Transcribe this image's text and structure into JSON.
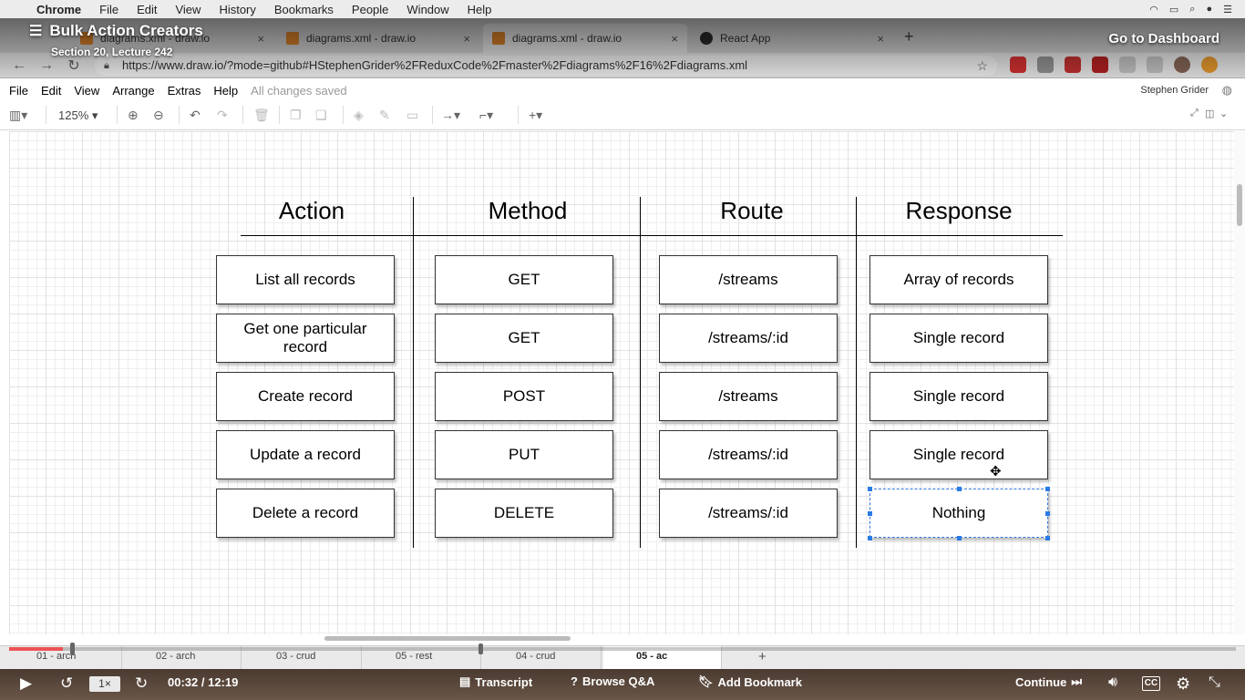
{
  "mac_menu": {
    "app": "Chrome",
    "items": [
      "File",
      "Edit",
      "View",
      "History",
      "Bookmarks",
      "People",
      "Window",
      "Help"
    ]
  },
  "browser": {
    "tabs": [
      {
        "title": "diagrams.xml - draw.io",
        "favicon_color": "#e8892c"
      },
      {
        "title": "diagrams.xml - draw.io",
        "favicon_color": "#e8892c"
      },
      {
        "title": "diagrams.xml - draw.io",
        "favicon_color": "#e8892c"
      },
      {
        "title": "React App",
        "favicon_color": "#2d2d2d"
      }
    ],
    "url": "https://www.draw.io/?mode=github#HStephenGrider%2FReduxCode%2Fmaster%2Fdiagrams%2F16%2Fdiagrams.xml"
  },
  "course": {
    "title": "Bulk Action Creators",
    "section": "Section 20, Lecture 242",
    "dashboard_link": "Go to Dashboard"
  },
  "drawio": {
    "menu": [
      "File",
      "Edit",
      "View",
      "Arrange",
      "Extras",
      "Help"
    ],
    "status": "All changes saved",
    "user": "Stephen Grider",
    "zoom": "125%"
  },
  "diagram": {
    "headers": [
      "Action",
      "Method",
      "Route",
      "Response"
    ],
    "rows": [
      [
        "List all records",
        "GET",
        "/streams",
        "Array of records"
      ],
      [
        "Get one particular record",
        "GET",
        "/streams/:id",
        "Single record"
      ],
      [
        "Create record",
        "POST",
        "/streams",
        "Single record"
      ],
      [
        "Update a record",
        "PUT",
        "/streams/:id",
        "Single record"
      ],
      [
        "Delete a record",
        "DELETE",
        "/streams/:id",
        "Nothing"
      ]
    ]
  },
  "page_tabs": [
    "01 - arch",
    "02 - arch",
    "03 - crud",
    "05 - rest",
    "04 - crud",
    "05 - ac"
  ],
  "player": {
    "speed": "1×",
    "time": "00:32 / 12:19",
    "progress_fraction": 0.044,
    "transcript": "Transcript",
    "qa": "Browse Q&A",
    "bookmark": "Add Bookmark",
    "continue": "Continue",
    "cc": "CC"
  },
  "colors": {
    "accent": "#ec5252",
    "selection": "#2a7be4"
  }
}
